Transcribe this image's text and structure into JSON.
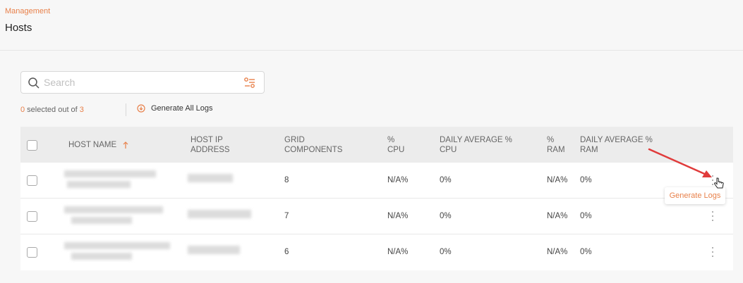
{
  "header": {
    "breadcrumb": "Management",
    "title": "Hosts"
  },
  "search": {
    "placeholder": "Search",
    "value": ""
  },
  "selection": {
    "count": "0",
    "prefix": " selected out of ",
    "total": "3"
  },
  "actions": {
    "generate_all": "Generate All Logs"
  },
  "table": {
    "headers": {
      "host_name": "HOST NAME",
      "host_ip_1": "HOST IP",
      "host_ip_2": "ADDRESS",
      "grid_1": "GRID",
      "grid_2": "COMPONENTS",
      "cpu_1": "%",
      "cpu_2": "CPU",
      "daily_cpu_1": "DAILY AVERAGE %",
      "daily_cpu_2": "CPU",
      "ram_1": "%",
      "ram_2": "RAM",
      "daily_ram_1": "DAILY AVERAGE %",
      "daily_ram_2": "RAM"
    },
    "rows": [
      {
        "grid_components": "8",
        "cpu": "N/A%",
        "daily_cpu": "0%",
        "ram": "N/A%",
        "daily_ram": "0%"
      },
      {
        "grid_components": "7",
        "cpu": "N/A%",
        "daily_cpu": "0%",
        "ram": "N/A%",
        "daily_ram": "0%"
      },
      {
        "grid_components": "6",
        "cpu": "N/A%",
        "daily_cpu": "0%",
        "ram": "N/A%",
        "daily_ram": "0%"
      }
    ]
  },
  "tooltip": {
    "label": "Generate Logs"
  },
  "colors": {
    "accent": "#e8804a",
    "arrow": "#e03b3b",
    "header_bg": "#ececec"
  },
  "icons": {
    "search": "search-icon",
    "filter": "filter-icon",
    "download": "download-circle-icon",
    "sort": "sort-up-icon",
    "more": "kebab-icon",
    "cursor": "hand-pointer-icon"
  }
}
